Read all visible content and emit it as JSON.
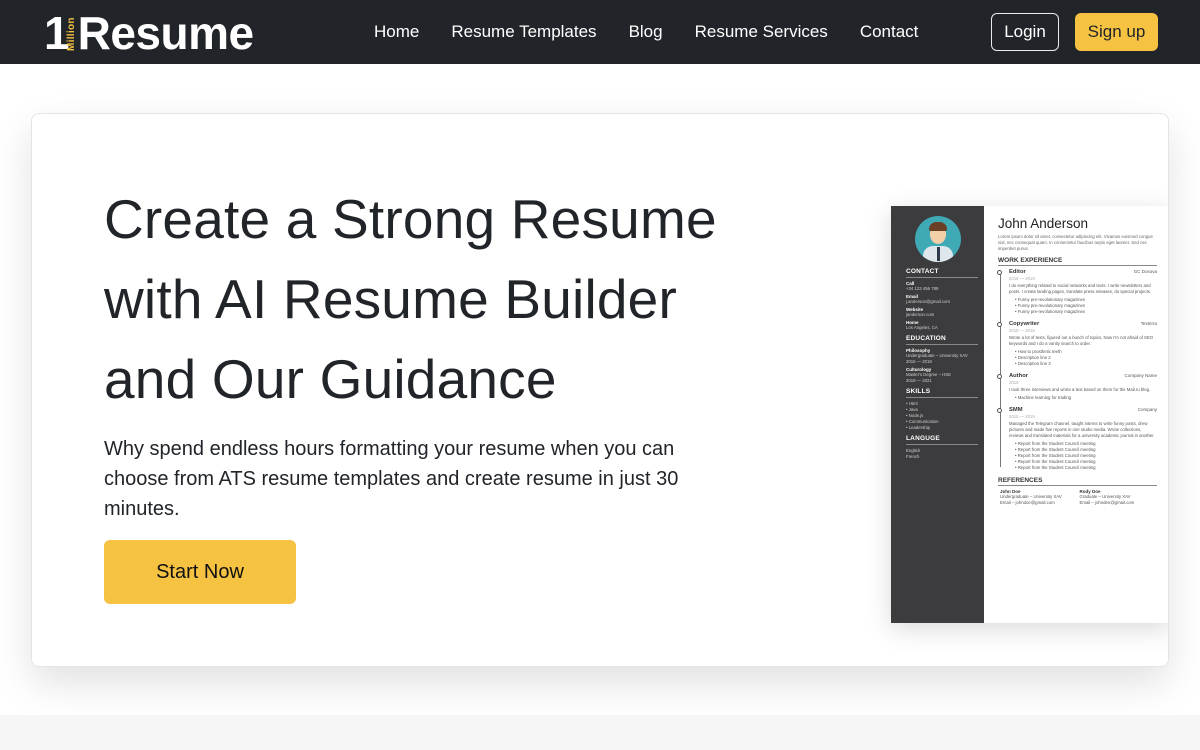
{
  "navbar": {
    "logo": {
      "one": "1",
      "million": "Million",
      "resume": "Resume"
    },
    "links": [
      "Home",
      "Resume Templates",
      "Blog",
      "Resume Services",
      "Contact"
    ],
    "login_label": "Login",
    "signup_label": "Sign up"
  },
  "hero": {
    "title_lines": [
      "Create a Strong Resume",
      "with AI Resume Builder",
      "and Our Guidance"
    ],
    "description": "Why spend endless hours formatting your resume when you can choose from ATS resume templates and create resume in just 30 minutes.",
    "cta_label": "Start Now"
  },
  "resume_preview": {
    "sidebar": {
      "contact_heading": "CONTACT",
      "contact": [
        {
          "label": "Call",
          "value": "+34 123 456 789"
        },
        {
          "label": "Email",
          "value": "j.anderson@gmail.com"
        },
        {
          "label": "Website",
          "value": "janderson.com"
        },
        {
          "label": "Home",
          "value": "Los Angeles, CA"
        }
      ],
      "education_heading": "EDUCATION",
      "education": [
        {
          "label": "Philosophy",
          "lines": [
            "Undergraduate – University XAV",
            "2015 — 2019"
          ]
        },
        {
          "label": "Culturology",
          "lines": [
            "Master's Degree – HSE",
            "2019 — 2021"
          ]
        }
      ],
      "skills_heading": "SKILLS",
      "skills": [
        "Html",
        "Java",
        "Node.js",
        "Communication",
        "Leadership"
      ],
      "language_heading": "LANGUGE",
      "languages": [
        "English",
        "French"
      ]
    },
    "name": "John Anderson",
    "intro": "Lorem ipsum dolor sit amet, consectetur adipiscing elit. Vivamus euismod congue nisl, nec consequat quam. In consectetur faucibus turpis eget laoreet. Sed nec imperdiet purus.",
    "work_heading": "WORK EXPERIENCE",
    "jobs": [
      {
        "title": "Editor",
        "company": "GC Dosova",
        "dates": "2018 — 2019",
        "desc": "I do everything related to social networks and texts. I write newsletters and posts. I create landing pages, translate press releases, do special projects.",
        "bullets": [
          "Funny pre-revolutionary magazines",
          "Funny pre-revolutionary magazines",
          "Funny pre-revolutionary magazines"
        ]
      },
      {
        "title": "Copywriter",
        "company": "Texterra",
        "dates": "2018 — 2019",
        "desc": "Wrote a lot of texts, figured out a bunch of topics. Now I'm not afraid of SEO keywords and I do a vanity search to order.",
        "bullets": [
          "How to prosthetic teeth",
          "Description line 2",
          "Description line 3"
        ]
      },
      {
        "title": "Author",
        "company": "Company Name",
        "dates": "2019",
        "desc": "I took three interviews and wrote a text based on them for the Mail.ru blog.",
        "bullets": [
          "Machine learning for trading"
        ]
      },
      {
        "title": "SMM",
        "company": "Company",
        "dates": "2015 — 2019",
        "desc": "Managed the Telegram channel, taught interns to write funny posts, drew pictures and made five reports in one studio media. Wrote collections, reviews and translated materials for a university academic journal in another",
        "bullets": [
          "Report from the Student Council meeting",
          "Report from the Student Council meeting",
          "Report from the Student Council meeting",
          "Report from the Student Council meeting",
          "Report from the Student Council meeting"
        ]
      }
    ],
    "references_heading": "REFERENCES",
    "references": [
      {
        "name": "John Doe",
        "lines": [
          "Undergraduate – University XAV",
          "Email – johndoe@gmail.com"
        ]
      },
      {
        "name": "Rody Doe",
        "lines": [
          "Graduate – University XAV",
          "Email – johnden@gmail.com"
        ]
      }
    ]
  }
}
